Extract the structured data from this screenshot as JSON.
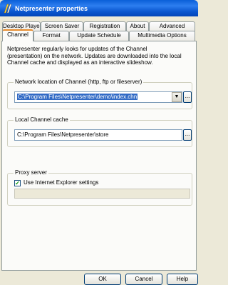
{
  "window": {
    "title": "Netpresenter properties"
  },
  "tabs": {
    "back": [
      "Desktop Player",
      "Screen Saver",
      "Registration",
      "About",
      "Advanced"
    ],
    "front": [
      "Channel",
      "Format",
      "Update Schedule",
      "Multimedia Options"
    ],
    "active": "Channel"
  },
  "description": {
    "lines": [
      "Netpresenter regularly looks for updates of the Channel",
      "(presentation) on the network. Updates are downloaded into the local",
      "Channel cache and displayed as an interactive slideshow."
    ]
  },
  "network": {
    "label": "Network location of Channel (http, ftp or fileserver)",
    "value": "C:\\Program Files\\Netpresenter\\demo\\index.chn",
    "browse": "..."
  },
  "cache": {
    "label": "Local Channel cache",
    "value": "C:\\Program Files\\Netpresenter\\store",
    "browse": "..."
  },
  "proxy": {
    "label": "Proxy server",
    "checkbox_label": "Use Internet Explorer settings",
    "checked": true
  },
  "buttons": {
    "ok": "OK",
    "cancel": "Cancel",
    "help": "Help"
  },
  "colors": {
    "titlebar": "#0a56d0",
    "selection": "#316ac5",
    "tab_highlight": "#e68b2c"
  }
}
